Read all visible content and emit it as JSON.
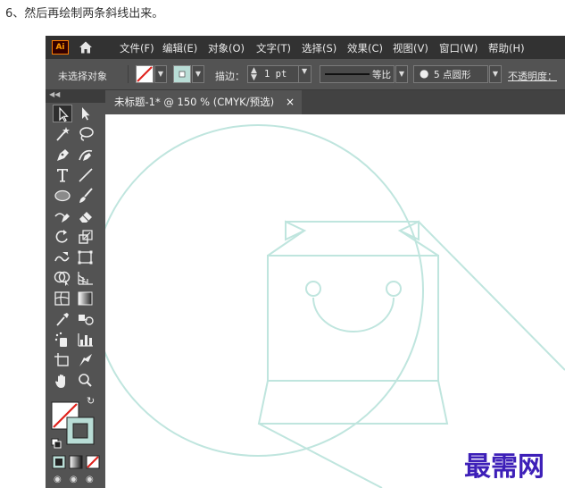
{
  "caption": "6、然后再绘制两条斜线出来。",
  "app": {
    "logo": "Ai",
    "menu": [
      "文件(F)",
      "编辑(E)",
      "对象(O)",
      "文字(T)",
      "选择(S)",
      "效果(C)",
      "视图(V)",
      "窗口(W)",
      "帮助(H)"
    ]
  },
  "controlbar": {
    "selection_status": "未选择对象",
    "stroke_label": "描边：",
    "stroke_weight": "1 pt",
    "stroke_profile": "等比",
    "brush": "5 点圆形",
    "opacity_label": "不透明度："
  },
  "document": {
    "tab_title": "未标题-1* @ 150 % (CMYK/预选)",
    "close_symbol": "×"
  },
  "colors": {
    "stroke_accent": "#bfe5de",
    "fill_swatch": "#b9ddd6",
    "app_bg": "#535353",
    "menubar_bg": "#323232"
  },
  "tools": [
    "selection-tool",
    "direct-selection-tool",
    "magic-wand-tool",
    "lasso-tool",
    "pen-tool",
    "curvature-tool",
    "type-tool",
    "line-tool",
    "ellipse-tool",
    "paintbrush-tool",
    "shaper-tool",
    "eraser-tool",
    "rotate-tool",
    "scale-tool",
    "warp-tool",
    "free-transform-tool",
    "shape-builder-tool",
    "perspective-grid-tool",
    "mesh-tool",
    "gradient-tool",
    "eyedropper-tool",
    "blend-tool",
    "symbol-sprayer-tool",
    "column-graph-tool",
    "artboard-tool",
    "slice-tool",
    "hand-tool",
    "zoom-tool"
  ],
  "watermark": "最需网"
}
